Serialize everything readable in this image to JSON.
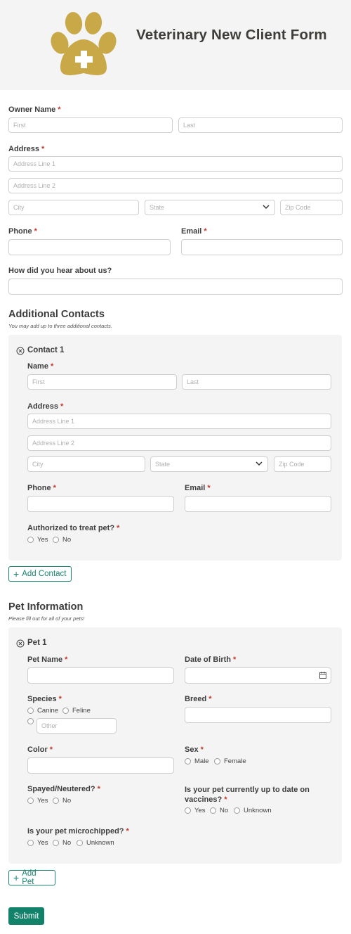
{
  "header": {
    "title": "Veterinary New Client Form",
    "logo_icon": "paw-medical-cross-icon",
    "logo_color": "#c9a847"
  },
  "colors": {
    "accent": "#17856f",
    "required": "#c0392b",
    "panel_bg": "#f4f4f4"
  },
  "owner": {
    "name_label": "Owner Name",
    "first_placeholder": "First",
    "last_placeholder": "Last",
    "address_label": "Address",
    "address1_placeholder": "Address Line 1",
    "address2_placeholder": "Address Line 2",
    "city_placeholder": "City",
    "state_placeholder": "State",
    "zip_placeholder": "Zip Code",
    "phone_label": "Phone",
    "email_label": "Email",
    "hear_label": "How did you hear about us?"
  },
  "contacts": {
    "title": "Additional Contacts",
    "subtitle": "You may add up to three additional contacts.",
    "contact_title": "Contact 1",
    "name_label": "Name",
    "first_placeholder": "First",
    "last_placeholder": "Last",
    "address_label": "Address",
    "address1_placeholder": "Address Line 1",
    "address2_placeholder": "Address Line 2",
    "city_placeholder": "City",
    "state_placeholder": "State",
    "zip_placeholder": "Zip Code",
    "phone_label": "Phone",
    "email_label": "Email",
    "authorized_label": "Authorized to treat pet?",
    "yes": "Yes",
    "no": "No",
    "add_button": "Add Contact"
  },
  "pets": {
    "title": "Pet Information",
    "subtitle": "Please fill out for all of your pets!",
    "pet_title": "Pet 1",
    "name_label": "Pet Name",
    "dob_label": "Date of Birth",
    "species_label": "Species",
    "species_options": [
      "Canine",
      "Feline"
    ],
    "other_placeholder": "Other",
    "breed_label": "Breed",
    "color_label": "Color",
    "sex_label": "Sex",
    "sex_options": [
      "Male",
      "Female"
    ],
    "spayed_label": "Spayed/Neutered?",
    "vaccines_label_line1": "Is your pet currently up to date on",
    "vaccines_label_line2": "vaccines?",
    "microchip_label": "Is your pet microchipped?",
    "yes": "Yes",
    "no": "No",
    "unknown": "Unknown",
    "add_button": "Add Pet"
  },
  "submit_label": "Submit"
}
